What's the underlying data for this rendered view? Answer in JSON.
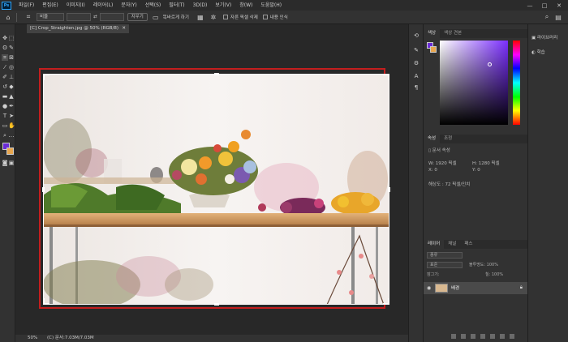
{
  "app": {
    "logo": "Ps"
  },
  "menu": [
    "파일(F)",
    "편집(E)",
    "이미지(I)",
    "레이어(L)",
    "문자(Y)",
    "선택(S)",
    "필터(T)",
    "3D(D)",
    "보기(V)",
    "창(W)",
    "도움말(H)"
  ],
  "window_controls": [
    "—",
    "□",
    "✕"
  ],
  "options": {
    "ratio_select": "비율",
    "swap_symbol": "⇄",
    "clear_button": "지우기",
    "straighten_label": "똑바르게 하기",
    "delete_cropped_label": "자른 픽셀 삭제",
    "content_aware_label": "내용 인식"
  },
  "doc_tab": {
    "title": "[C] Crop_Straighten.jpg @ 50% (RGB/8)",
    "close": "✕"
  },
  "status": {
    "zoom": "50%",
    "doc": "(C) 문서:7.03M/7.03M"
  },
  "panels": {
    "color_tabs": [
      "색상",
      "색상 견본"
    ],
    "properties_tabs": [
      "속성",
      "조정"
    ],
    "doc_props_title": "문서 속성",
    "w": "W:  1920 픽셀",
    "h": "H:  1280 픽셀",
    "x": "X:  0",
    "y": "Y:  0",
    "resolution": "해상도 : 72 픽셀/인치",
    "layers_tabs": [
      "레이어",
      "채널",
      "패스"
    ],
    "kind_label": "종류",
    "blend_mode": "표준",
    "opacity": "불투명도: 100%",
    "lock_label": "잠그기:",
    "fill_label": "칠: 100%",
    "layer_name": "배경"
  },
  "right_strip": {
    "item1": "라이브러리",
    "item2": "학습"
  },
  "colors": {
    "foreground": "#6a2bd6",
    "background": "#e8a64e",
    "accent_red": "#c41e1e"
  }
}
